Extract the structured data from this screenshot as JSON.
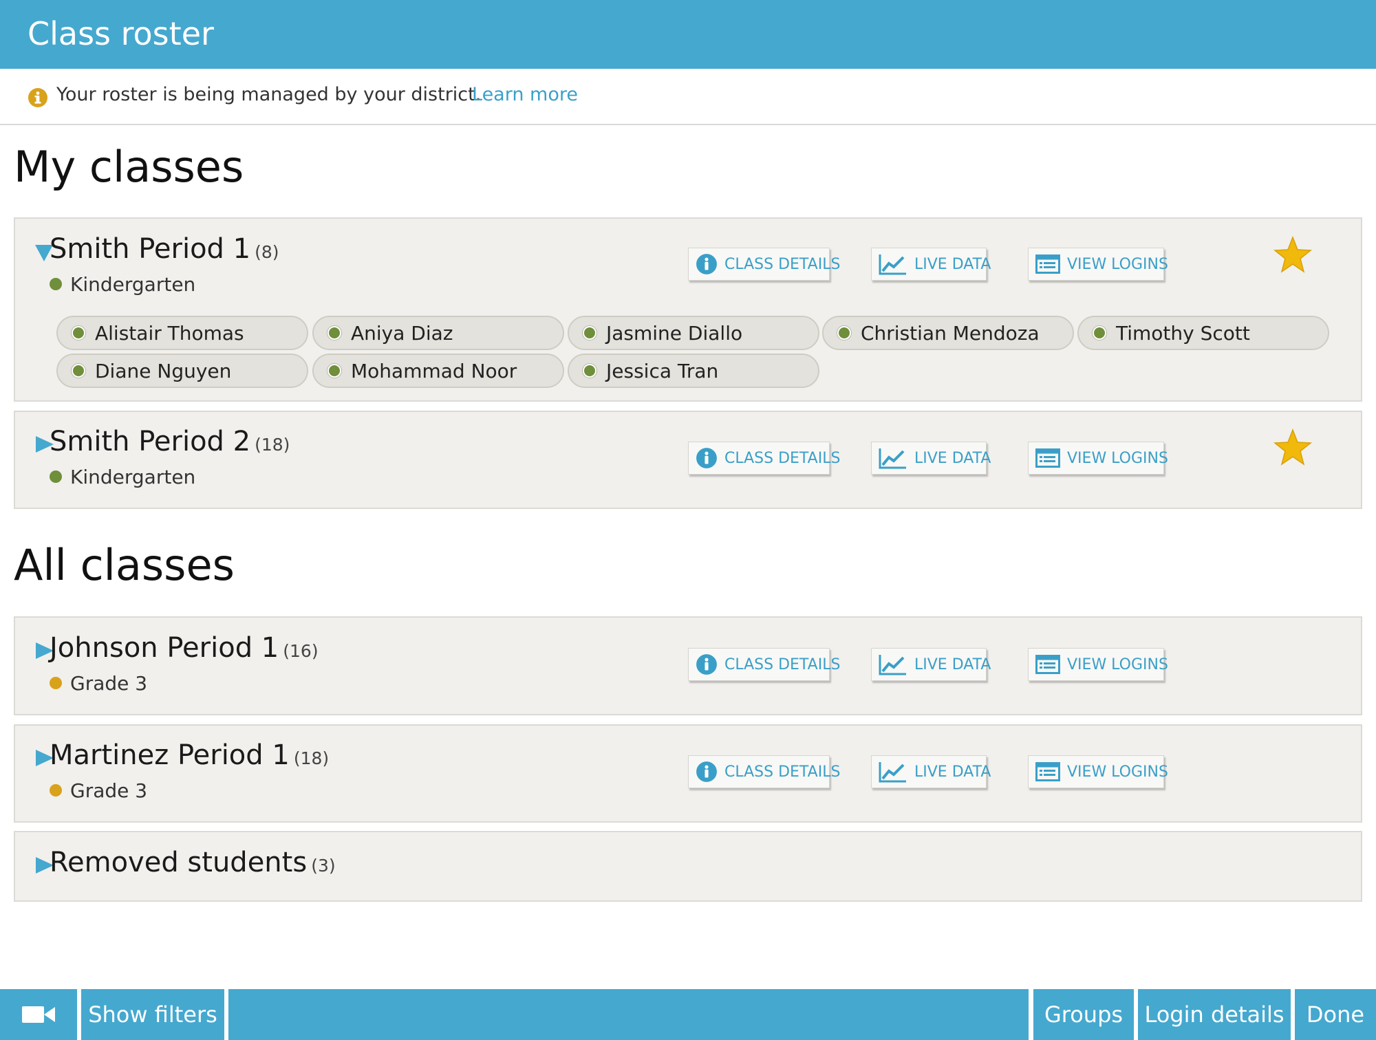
{
  "header": {
    "title": "Class roster"
  },
  "notice": {
    "text": "Your roster is being managed by your district.",
    "link": "Learn more"
  },
  "sections": {
    "my_classes": "My classes",
    "all_classes": "All classes"
  },
  "actions": {
    "class_details": "CLASS DETAILS",
    "live_data": "LIVE DATA",
    "view_logins": "VIEW LOGINS"
  },
  "classes": [
    {
      "name": "Smith Period 1",
      "count": "(8)",
      "grade": "Kindergarten",
      "grade_color": "#6f8f3a",
      "expanded": true,
      "favorite": true,
      "students": [
        "Alistair Thomas",
        "Aniya Diaz",
        "Jasmine Diallo",
        "Christian Mendoza",
        "Timothy Scott",
        "Diane Nguyen",
        "Mohammad Noor",
        "Jessica Tran"
      ]
    },
    {
      "name": "Smith Period 2",
      "count": "(18)",
      "grade": "Kindergarten",
      "grade_color": "#6f8f3a",
      "expanded": false,
      "favorite": true
    },
    {
      "name": "Johnson Period 1",
      "count": "(16)",
      "grade": "Grade 3",
      "grade_color": "#d9a21b",
      "expanded": false,
      "favorite": false
    },
    {
      "name": "Martinez Period 1",
      "count": "(18)",
      "grade": "Grade 3",
      "grade_color": "#d9a21b",
      "expanded": false,
      "favorite": false
    }
  ],
  "removed": {
    "name": "Removed students",
    "count": "(3)"
  },
  "footer": {
    "show_filters": "Show filters",
    "groups": "Groups",
    "login_details": "Login details",
    "done": "Done"
  },
  "colors": {
    "accent": "#45a8cf",
    "link": "#3aa0c9",
    "star": "#f0b90b",
    "kindergarten": "#6f8f3a",
    "grade3": "#d9a21b"
  },
  "icons": {
    "notice": "info-circle-icon",
    "toggle_open": "triangle-down-icon",
    "toggle_closed": "triangle-right-icon",
    "favorite": "star-icon",
    "camera": "video-camera-icon"
  }
}
